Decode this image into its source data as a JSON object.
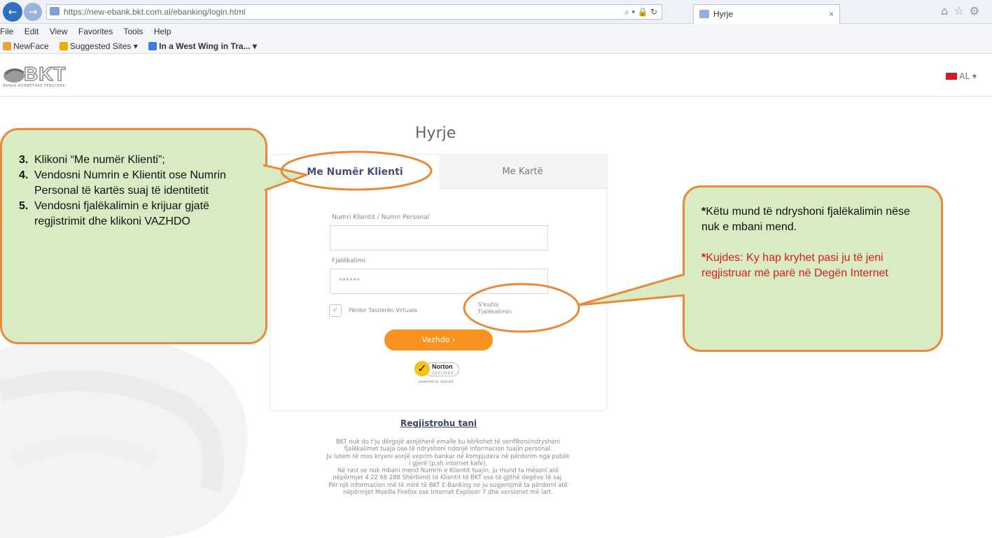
{
  "browser": {
    "url": "https://new-ebank.bkt.com.al/ebanking/login.html",
    "url_tools": "⌕ ▾ 🔒 ↻",
    "tab_title": "Hyrje",
    "tab_close": "×",
    "menu": [
      "File",
      "Edit",
      "View",
      "Favorites",
      "Tools",
      "Help"
    ],
    "favorites": [
      "NewFace",
      "Suggested Sites ▾",
      "In a West Wing in Tra... ▾"
    ]
  },
  "header": {
    "logo_text": "BKT",
    "logo_sub": "BANKA KOMBËTARE TREGTARE",
    "language": "AL ▾"
  },
  "login": {
    "title": "Hyrje",
    "tab_client": "Me Numër Klienti",
    "tab_card": "Me Kartë",
    "client_label": "Numri Klientit / Numri Personal",
    "password_label": "Fjalëkalimi",
    "password_value": "******",
    "virtual_keyboard_label": "Përdor Tastierën Virtuale",
    "checkbox_mark": "✓",
    "forgot_line1": "S'kujtoj",
    "forgot_line2": "Fjalëkalimin",
    "continue_button": "Vazhdo ›",
    "norton_name": "Norton",
    "norton_secured": "SECURED",
    "norton_powered": "powered by digicert",
    "register_link": "Regjistrohu tani",
    "info_lines": [
      "BKT nuk do t'ju dërgojë asnjëherë emaile ku kërkohet të verifikoni/ndryshoni",
      "fjalëkalimet tuaja ose të ndryshoni ndonjë informacion tuajin personal.",
      "Ju lutem të mos kryeni asnjë veprim bankar në kompjutera në përdorim nga publik",
      "i gjerë (p.sh internet kafe).",
      "Në rast se nuk mbani mend Numrin e Klientit tuajin, ju mund ta mësoni atë",
      "nëpërmjet 4 22 66 288 Shërbimit të Klientit të BKT ose të gjithë degëve të saj.",
      "Për një informacion më të mirë të BKT E-Banking ne ju sugjerojmë ta përdorni atë",
      "nëpërmjet Moxilla Firefox ose Internet Explorer 7 dhe versionet më lart."
    ]
  },
  "annotations": {
    "left": [
      {
        "num": "3.",
        "text": "Klikoni “Me numër Klienti”;"
      },
      {
        "num": "4.",
        "text": "Vendosni Numrin e Klientit ose Numrin Personal të kartës suaj të identitetit"
      },
      {
        "num": "5.",
        "text": "Vendosni fjalëkalimin e krijuar gjatë regjistrimit dhe klikoni VAZHDO"
      }
    ],
    "right_star": "*",
    "right_note": "Këtu mund të ndryshoni fjalëkalimin nëse nuk e mbani mend.",
    "right_warning": "Kujdes: Ky hap kryhet pasi ju të jeni regjistruar më parë në Degën Internet"
  },
  "colors": {
    "accent_orange": "#f7931e",
    "callout_fill": "#d8ebc2",
    "callout_border": "#e88a3a",
    "warning_red": "#d91c1c"
  }
}
